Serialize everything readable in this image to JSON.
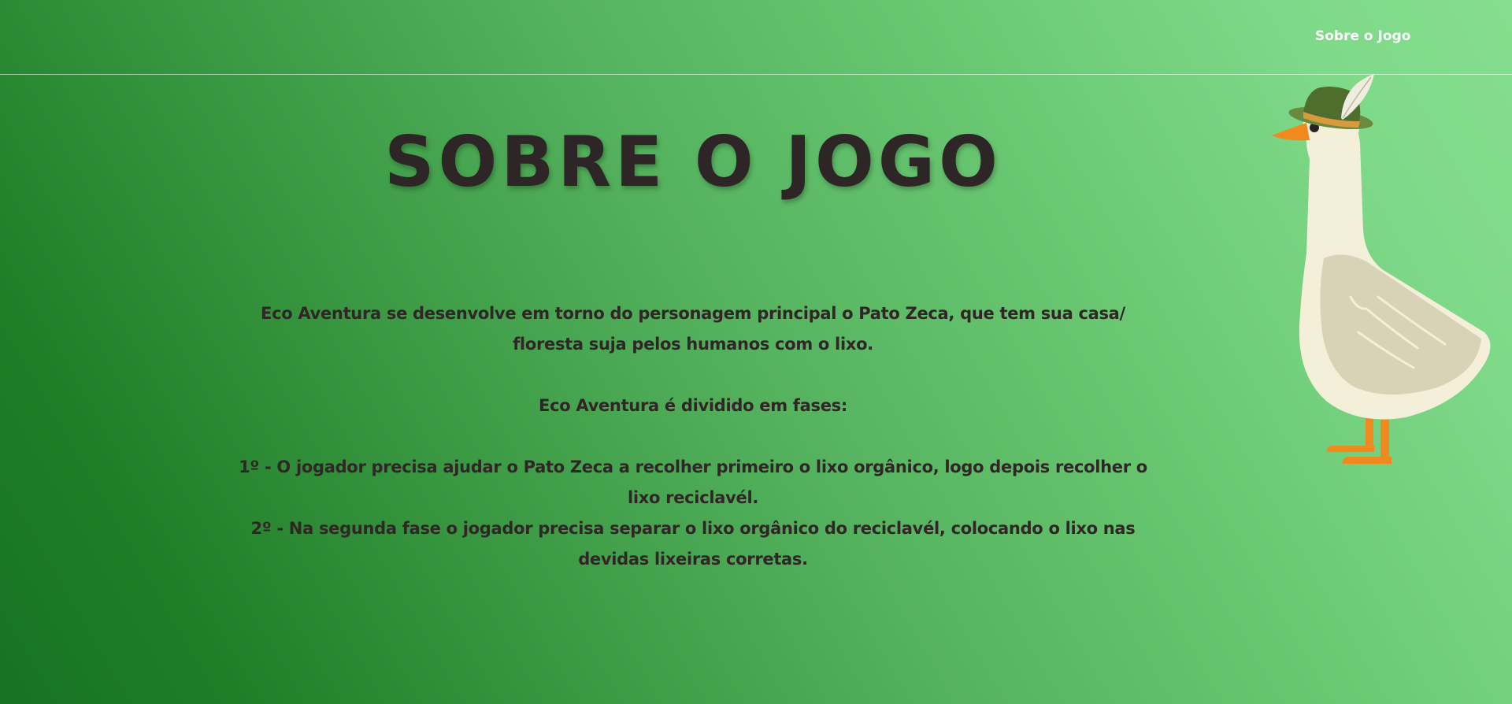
{
  "nav": {
    "about_link": "Sobre o Jogo"
  },
  "hero": {
    "title": "SOBRE O JOGO"
  },
  "content": {
    "intro": "Eco Aventura se desenvolve em torno do personagem principal o Pato Zeca, que tem sua casa/ floresta suja pelos humanos com o lixo.",
    "phases_heading": "Eco Aventura é dividido em fases:",
    "phase_1": "1º - O jogador precisa ajudar o Pato Zeca a recolher primeiro o lixo orgânico, logo depois recolher o lixo reciclavél.",
    "phase_2": "2º -  Na segunda fase o jogador precisa separar o lixo orgânico do reciclavél, colocando o lixo nas devidas lixeiras corretas."
  },
  "illustration": {
    "icon": "goose-with-hat-illustration"
  },
  "colors": {
    "background_dark": "#177322",
    "background_light": "#84de8d",
    "title_text": "#2e2526",
    "body_text": "#322527",
    "nav_text": "#ffffff"
  }
}
